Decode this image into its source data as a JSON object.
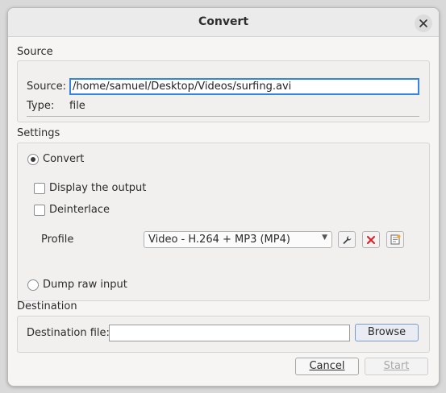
{
  "window": {
    "title": "Convert"
  },
  "source": {
    "group_label": "Source",
    "source_label": "Source:",
    "source_value": "/home/samuel/Desktop/Videos/surfing.avi",
    "type_label": "Type:",
    "type_value": "file"
  },
  "settings": {
    "group_label": "Settings",
    "convert_label": "Convert",
    "display_output_label": "Display the output",
    "deinterlace_label": "Deinterlace",
    "profile_label": "Profile",
    "profile_value": "Video - H.264 + MP3 (MP4)",
    "dump_raw_label": "Dump raw input",
    "convert_selected": true,
    "display_output_checked": false,
    "deinterlace_checked": false,
    "profile_tools": [
      "wrench-icon",
      "delete-icon",
      "new-profile-icon"
    ]
  },
  "destination": {
    "group_label": "Destination",
    "file_label": "Destination file:",
    "file_value": "",
    "browse_label": "Browse"
  },
  "footer": {
    "cancel_label": "Cancel",
    "start_label": "Start"
  },
  "colors": {
    "accent": "#3584e4",
    "delete_red": "#e01b24"
  }
}
